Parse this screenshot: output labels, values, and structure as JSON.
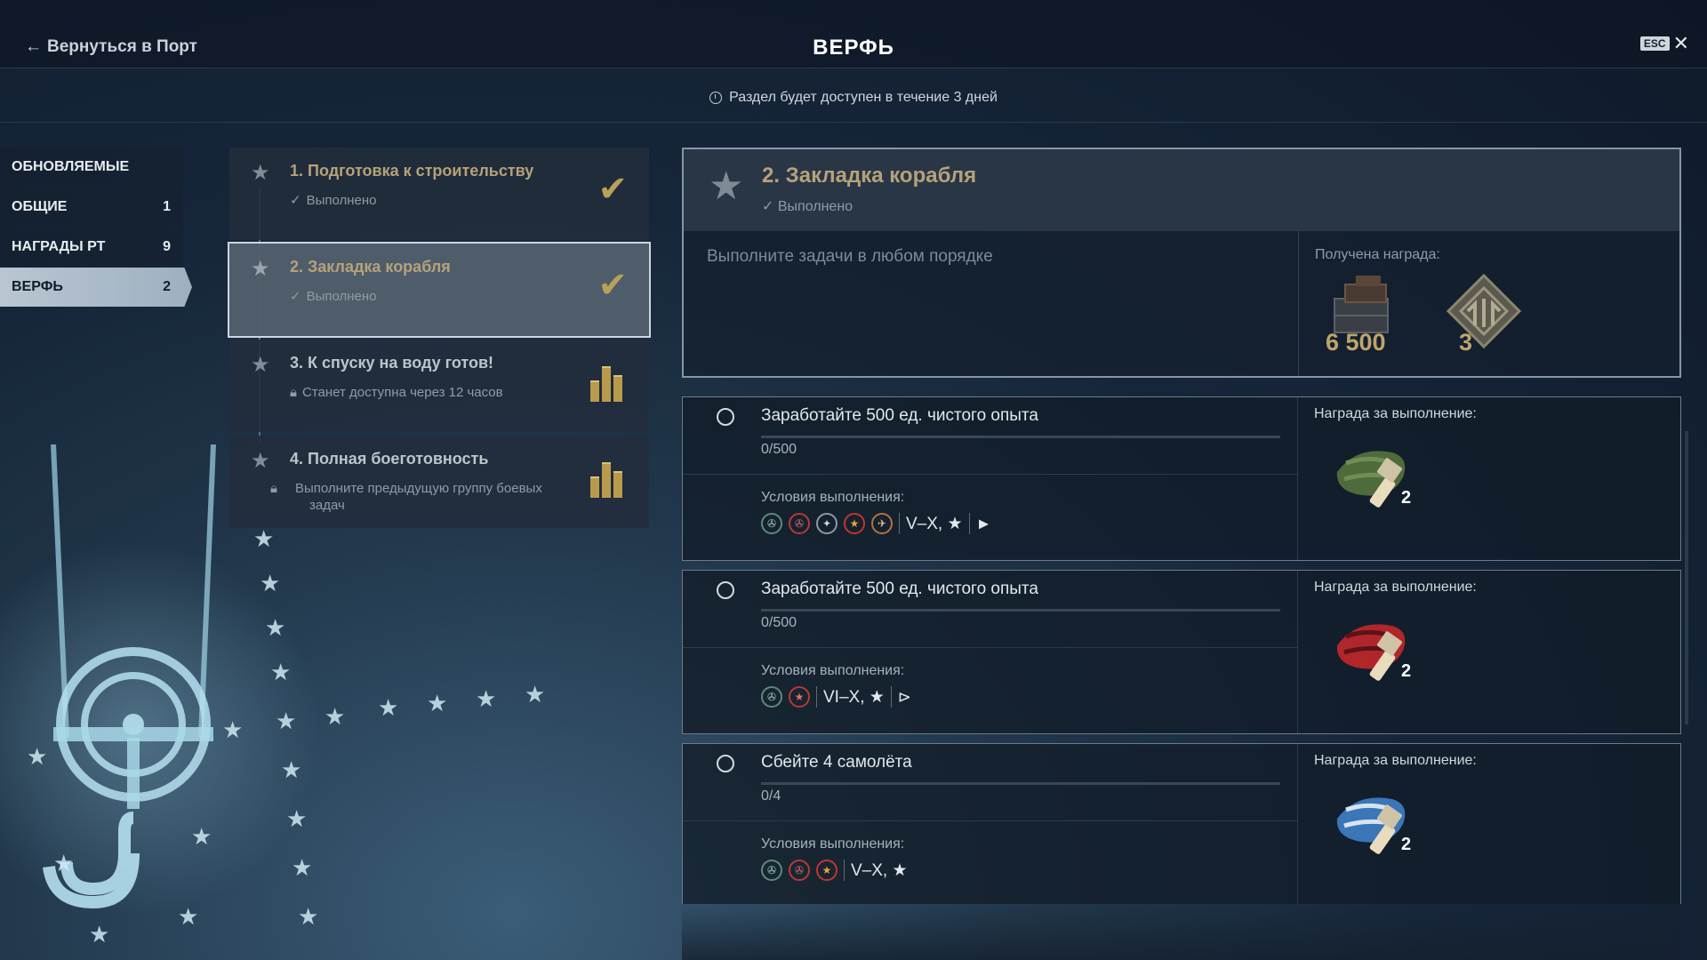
{
  "header": {
    "back_label": "Вернуться в Порт",
    "title": "ВЕРФЬ",
    "esc_label": "ESC",
    "close_glyph": "✕"
  },
  "notice": {
    "text": "Раздел будет доступен в течение 3 дней",
    "icon": "clock-icon"
  },
  "nav": {
    "items": [
      {
        "label": "ОБНОВЛЯЕМЫЕ",
        "count": ""
      },
      {
        "label": "ОБЩИЕ",
        "count": "1"
      },
      {
        "label": "НАГРАДЫ РТ",
        "count": "9"
      },
      {
        "label": "ВЕРФЬ",
        "count": "2"
      }
    ],
    "active_index": 3
  },
  "stages": [
    {
      "name": "1. Подготовка к строительству",
      "status": "Выполнено",
      "state": "done"
    },
    {
      "name": "2. Закладка корабля",
      "status": "Выполнено",
      "state": "done",
      "selected": true
    },
    {
      "name": "3. К спуску на воду готов!",
      "status": "Станет доступна через 12 часов",
      "state": "locked"
    },
    {
      "name": "4. Полная боеготовность",
      "status": "Выполните предыдущую группу боевых задач",
      "state": "locked"
    }
  ],
  "detail": {
    "name": "2. Закладка корабля",
    "status": "Выполнено",
    "hint": "Выполните задачи в любом порядке",
    "reward_label": "Получена награда:",
    "rewards": [
      {
        "icon": "steel-crate-icon",
        "value": "6 500"
      },
      {
        "icon": "shipyard-emblem-icon",
        "value": "3"
      }
    ]
  },
  "tasks": [
    {
      "name": "Заработайте 500 ед. чистого опыта",
      "progress": "0/500",
      "progress_fraction": 0,
      "conditions_label": "Условия выполнения:",
      "nation_icons": [
        "nation-1-icon",
        "nation-2-icon",
        "nation-3-icon",
        "nation-4-icon",
        "nation-5-icon"
      ],
      "tiers": "V–X, ★",
      "reward_label": "Награда за выполнение:",
      "reward_icon": "camo-green-icon",
      "reward_count": "2",
      "reward_color": "#4f6b3b"
    },
    {
      "name": "Заработайте 500 ед. чистого опыта",
      "progress": "0/500",
      "progress_fraction": 0,
      "conditions_label": "Условия выполнения:",
      "nation_icons": [
        "nation-1-icon",
        "nation-2-icon"
      ],
      "tiers": "VI–X, ★",
      "reward_label": "Награда за выполнение:",
      "reward_icon": "camo-red-icon",
      "reward_count": "2",
      "reward_color": "#b0262b"
    },
    {
      "name": "Сбейте 4 самолёта",
      "progress": "0/4",
      "progress_fraction": 0,
      "conditions_label": "Условия выполнения:",
      "nation_icons": [
        "nation-1-icon",
        "nation-2-icon",
        "nation-3-icon"
      ],
      "tiers": "V–X, ★",
      "reward_label": "Награда за выполнение:",
      "reward_icon": "camo-blue-icon",
      "reward_count": "2",
      "reward_color": "#3a76b8"
    }
  ],
  "colors": {
    "accent_gold": "#b5a27a",
    "active_nav": "#b9c6d2"
  }
}
